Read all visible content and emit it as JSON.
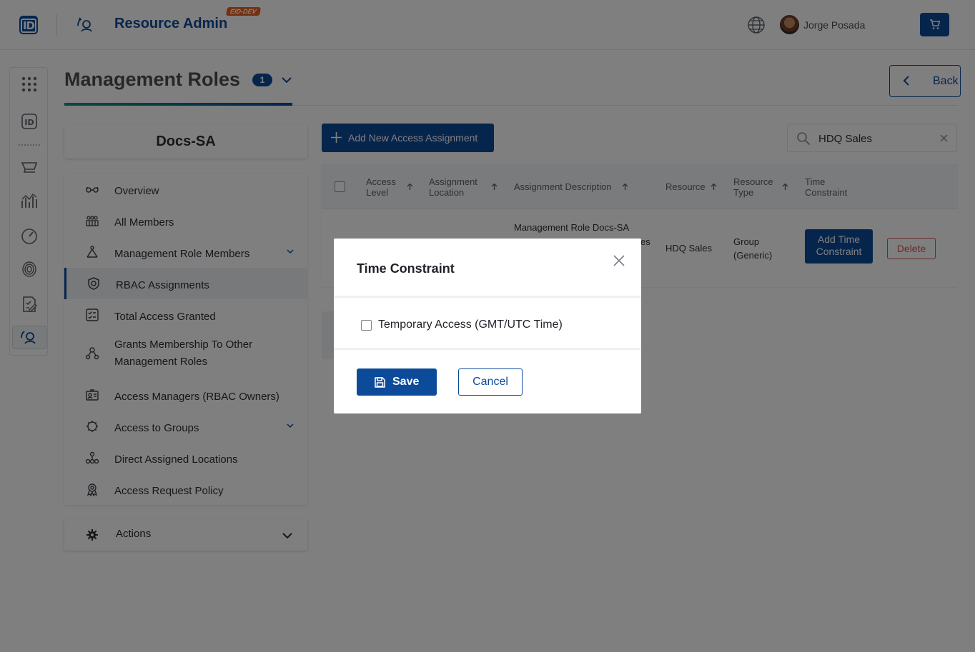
{
  "header": {
    "app_title": "Resource Admin",
    "env_badge": "EID-DEV",
    "user_name": "Jorge Posada"
  },
  "page": {
    "title": "Management Roles",
    "count": "1",
    "back_label": "Back"
  },
  "entity": {
    "name": "Docs-SA"
  },
  "nav": {
    "items": [
      {
        "label": "Overview"
      },
      {
        "label": "All Members"
      },
      {
        "label": "Management Role Members"
      },
      {
        "label": "RBAC Assignments"
      },
      {
        "label": "Total Access Granted"
      },
      {
        "label": "Grants Membership To Other Management Roles"
      },
      {
        "label": "Access Managers (RBAC Owners)"
      },
      {
        "label": "Access to Groups"
      },
      {
        "label": "Direct Assigned Locations"
      },
      {
        "label": "Access Request Policy"
      }
    ],
    "actions_label": "Actions"
  },
  "toolbar": {
    "add_label": "Add New Access Assignment",
    "search_value": "HDQ Sales"
  },
  "grid": {
    "columns": {
      "access_level": "Access Level",
      "assignment_location": "Assignment Location",
      "assignment_description": "Assignment Description",
      "resource": "Resource",
      "resource_type": "Resource Type",
      "time_constraint": "Time Constraint"
    },
    "rows": [
      {
        "assignment_description": "Management Role Docs-SA",
        "description_tail": "es",
        "resource": "HDQ Sales",
        "resource_type": "Group (Generic)",
        "time_action": "Add Time Constraint",
        "delete_label": "Delete"
      }
    ]
  },
  "modal": {
    "title": "Time Constraint",
    "checkbox_label": "Temporary Access (GMT/UTC Time)",
    "save_label": "Save",
    "cancel_label": "Cancel"
  },
  "colors": {
    "brand": "#0c4b9a",
    "accent_teal": "#1f8f7c",
    "badge_orange": "#e9611f",
    "danger": "#d9534f"
  },
  "icons": {
    "nav": [
      "glasses-icon",
      "group-icon",
      "hierarchy-icon",
      "shield-icon",
      "checklist-icon",
      "people-network-icon",
      "id-card-icon",
      "gear-group-icon",
      "location-network-icon",
      "badge-icon"
    ]
  }
}
